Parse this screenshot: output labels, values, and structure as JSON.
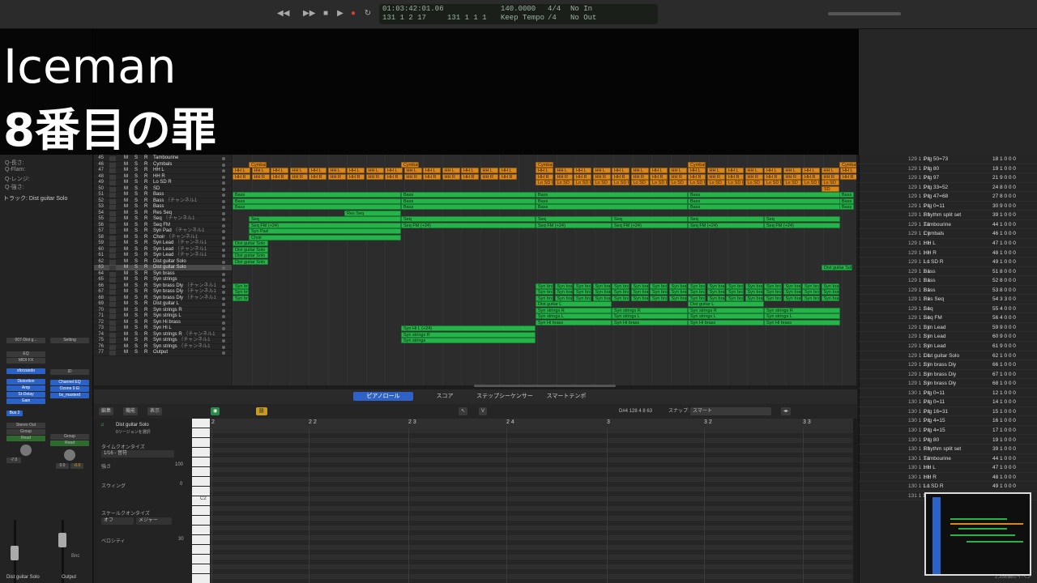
{
  "overlay": {
    "title": "Iceman",
    "subtitle": "8番目の罪"
  },
  "lcd": {
    "time": "01:03:42:01.06",
    "bar": "131  1  2  17",
    "bar2": "131  1  1  1",
    "tempo": "140.0000",
    "tempo_label": "Keep Tempo",
    "sig": "4/4",
    "sig_label": "/4",
    "in": "No In",
    "out": "No Out"
  },
  "inspector": {
    "track_label": "トラック: Dist guitar Solo",
    "rows": [
      "Q-長さ:",
      "Q-Flam:",
      "Q-レンジ:",
      "Q-強さ:"
    ],
    "strip1": {
      "name": "007-Dist g...",
      "eq": "EQ",
      "midifx": "MIDI FX",
      "inst": "sforzando",
      "fx": [
        "Distortion",
        "Amp",
        "St-Delay",
        "Gain"
      ],
      "send": "Bus 2",
      "out": "Stereo Out",
      "group": "Group",
      "auto": "Read",
      "vol": "-7.0",
      "label": "Dist guitar Solo"
    },
    "strip2": {
      "setting": "Setting",
      "id": "ID",
      "fx": [
        "Channel EQ",
        "Ozone 9 El",
        "bx_masterd"
      ],
      "group": "Group",
      "auto": "Read",
      "vol1": "0.0",
      "vol2": "-0.0",
      "bnc": "Bnc",
      "label": "Output"
    },
    "m": "M",
    "s": "S"
  },
  "tracks": [
    {
      "n": "45",
      "name": "Tambourine",
      "ch": ""
    },
    {
      "n": "46",
      "name": "Cymbals",
      "ch": ""
    },
    {
      "n": "47",
      "name": "HH L",
      "ch": ""
    },
    {
      "n": "48",
      "name": "HH R",
      "ch": ""
    },
    {
      "n": "49",
      "name": "Lo SD R",
      "ch": ""
    },
    {
      "n": "50",
      "name": "SD",
      "ch": ""
    },
    {
      "n": "51",
      "name": "Bass",
      "ch": ""
    },
    {
      "n": "52",
      "name": "Bass",
      "ch": "（チャンネル1"
    },
    {
      "n": "53",
      "name": "Bass",
      "ch": ""
    },
    {
      "n": "54",
      "name": "Res Seq",
      "ch": ""
    },
    {
      "n": "55",
      "name": "Seq",
      "ch": "（チャンネル1"
    },
    {
      "n": "56",
      "name": "Seq FM",
      "ch": ""
    },
    {
      "n": "57",
      "name": "Syn Pad",
      "ch": "（チャンネル1"
    },
    {
      "n": "58",
      "name": "Choir",
      "ch": "（チャンネル1"
    },
    {
      "n": "59",
      "name": "Syn Lead",
      "ch": "（チャンネル1"
    },
    {
      "n": "60",
      "name": "Syn Lead",
      "ch": "（チャンネル1"
    },
    {
      "n": "61",
      "name": "Syn Lead",
      "ch": "（チャンネル1"
    },
    {
      "n": "62",
      "name": "Dist guitar Solo",
      "ch": ""
    },
    {
      "n": "63",
      "name": "Dist guitar Solo",
      "ch": ""
    },
    {
      "n": "64",
      "name": "Syn brass",
      "ch": ""
    },
    {
      "n": "65",
      "name": "Syn strings",
      "ch": ""
    },
    {
      "n": "66",
      "name": "Syn brass Dly",
      "ch": "（チャンネル1"
    },
    {
      "n": "67",
      "name": "Syn brass Dly",
      "ch": "（チャンネル1"
    },
    {
      "n": "68",
      "name": "Syn brass Dly",
      "ch": "（チャンネル1"
    },
    {
      "n": "69",
      "name": "Dist guitar L",
      "ch": ""
    },
    {
      "n": "70",
      "name": "Syn strings R",
      "ch": ""
    },
    {
      "n": "71",
      "name": "Syn strings L",
      "ch": ""
    },
    {
      "n": "72",
      "name": "Syn Hi brass",
      "ch": ""
    },
    {
      "n": "73",
      "name": "Syn Hi L",
      "ch": ""
    },
    {
      "n": "74",
      "name": "Syn strings R",
      "ch": "（チャンネル1"
    },
    {
      "n": "75",
      "name": "Syn strings",
      "ch": "（チャンネル1"
    },
    {
      "n": "76",
      "name": "Syn strings",
      "ch": "（チャンネル1"
    },
    {
      "n": "77",
      "name": "Output",
      "ch": ""
    }
  ],
  "regions": {
    "cymbal": "Cymbal",
    "hhl": "HH L",
    "hhr": "HH R",
    "losd": "Lo SD",
    "losdr": "Lo SD R",
    "sd": "SD",
    "bass": "Bass",
    "resseq": "Res Seq",
    "seq": "Seq",
    "seqfm": "Seq FM (+24)",
    "synpad": "Syn Pad",
    "choir": "Choir",
    "distsolo": "Dist guitar Solo",
    "synbra": "Syn bra",
    "distl": "Dist guitar L",
    "strr": "Syn strings R",
    "strl": "Syn strings L",
    "hibrass": "Syn Hi brass",
    "hil": "Syn Hi L (+24)",
    "strr2": "Syn strings R",
    "str": "Syn strings"
  },
  "editor": {
    "tabs": [
      "ピアノロール",
      "スコア",
      "ステップシーケンサー",
      "スマートテンポ"
    ],
    "menus": [
      "編集",
      "機能",
      "表示"
    ],
    "pos": "D#4  128 4 8 63",
    "snap_label": "スナップ:",
    "snap": "スマート",
    "region_name": "Dist guitar Solo",
    "region_sub": "0リージョンを選択",
    "time_q": "タイムクオンタイズ",
    "time_q_val": "1/16 - 音符",
    "strength": "強さ",
    "strength_val": "100",
    "swing": "スウィング",
    "swing_val": "0",
    "scale_q": "スケールクオンタイズ",
    "scale_off": "オフ",
    "scale_major": "メジャー",
    "velocity": "ベロシティ",
    "velocity_val": "30",
    "c2": "C2",
    "ruler": [
      "2",
      "2 2",
      "2 3",
      "2 4",
      "3",
      "3 2",
      "3 3"
    ]
  },
  "events": [
    {
      "p": "129  1  1   1",
      "n": "Prg 50=73",
      "c": "18   1  0  0  0"
    },
    {
      "p": "129  1  1   1",
      "n": "Prg 80",
      "c": "19   1  0  0  0"
    },
    {
      "p": "129  1  1   1",
      "n": "Prg 97",
      "c": "21   9  0  0  0"
    },
    {
      "p": "129  1  1   1",
      "n": "Prg 33=52",
      "c": "24   8  0  0  0"
    },
    {
      "p": "129  1  1   1",
      "n": "Prg 47=68",
      "c": "27   8  0  0  0"
    },
    {
      "p": "129  1  1   1",
      "n": "Prg  0=11",
      "c": "30   9  0  0  0"
    },
    {
      "p": "129  1  1   1",
      "n": "Rhythm split set",
      "c": "39   1  0  0  0"
    },
    {
      "p": "129  1  1   1",
      "n": "Tambourine",
      "c": "44   1  0  0  0"
    },
    {
      "p": "129  1  1   1",
      "n": "Cymbals",
      "c": "46   1  0  0  0"
    },
    {
      "p": "129  1  1   1",
      "n": "HH L",
      "c": "47   1  0  0  0"
    },
    {
      "p": "129  1  1   1",
      "n": "HH R",
      "c": "48   1  0  0  0"
    },
    {
      "p": "129  1  1   1",
      "n": "Lo SD R",
      "c": "49   1  0  0  0"
    },
    {
      "p": "129  1  1   1",
      "n": "Bass",
      "c": "51   8  0  0  0"
    },
    {
      "p": "129  1  1   1",
      "n": "Bass",
      "c": "52   8  0  0  0"
    },
    {
      "p": "129  1  1   1",
      "n": "Bass",
      "c": "53   8  0  0  0"
    },
    {
      "p": "129  1  1   1",
      "n": "Res Seq",
      "c": "54   3  3  0  0"
    },
    {
      "p": "129  1  1   1",
      "n": "Seq",
      "c": "55   4  0  0  0"
    },
    {
      "p": "129  1  1   1",
      "n": "Seq FM",
      "c": "56   4  0  0  0"
    },
    {
      "p": "129  1  1   1",
      "n": "Syn Lead",
      "c": "59   9  0  0  0"
    },
    {
      "p": "129  1  1   1",
      "n": "Syn Lead",
      "c": "60   9  0  0  0"
    },
    {
      "p": "129  1  1   1",
      "n": "Syn Lead",
      "c": "61   9  0  0  0"
    },
    {
      "p": "129  1  1   1",
      "n": "Dist guitar Solo",
      "c": "62   1  0  0  0"
    },
    {
      "p": "129  1  1   1",
      "n": "Syn brass Dly",
      "c": "66   1  0  0  0"
    },
    {
      "p": "129  1  1   1",
      "n": "Syn brass Dly",
      "c": "67   1  0  0  0"
    },
    {
      "p": "129  1  1   1",
      "n": "Syn brass Dly",
      "c": "68   1  0  0  0"
    },
    {
      "p": "130  1  1   1",
      "n": "Prg  0=11",
      "c": "12   1  0  0  0"
    },
    {
      "p": "130  1  1   1",
      "n": "Prg  0=11",
      "c": "14   1  0  0  0"
    },
    {
      "p": "130  1  1   1",
      "n": "Prg 16=31",
      "c": "15   1  0  0  0"
    },
    {
      "p": "130  1  1   1",
      "n": "Prg  4=15",
      "c": "16   1  0  0  0"
    },
    {
      "p": "130  1  1   1",
      "n": "Prg  4=15",
      "c": "17   1  0  0  0"
    },
    {
      "p": "130  1  1   1",
      "n": "Prg 80",
      "c": "19   1  0  0  0"
    },
    {
      "p": "130  1  1   1",
      "n": "Rhythm split set",
      "c": "39   1  0  0  0"
    },
    {
      "p": "130  1  1   1",
      "n": "Tambourine",
      "c": "44   1  0  0  0"
    },
    {
      "p": "130  1  1   1",
      "n": "HH L",
      "c": "47   1  0  0  0"
    },
    {
      "p": "130  1  1   1",
      "n": "HH R",
      "c": "48   1  0  0  0"
    },
    {
      "p": "130  1  1   1",
      "n": "Lo SD R",
      "c": "49   1  0  0  0"
    },
    {
      "p": "131  1  1   1",
      "n": "Prg  4=15",
      "c": "17   1  0  0  0"
    }
  ],
  "event_count": "2,358個のイベン"
}
